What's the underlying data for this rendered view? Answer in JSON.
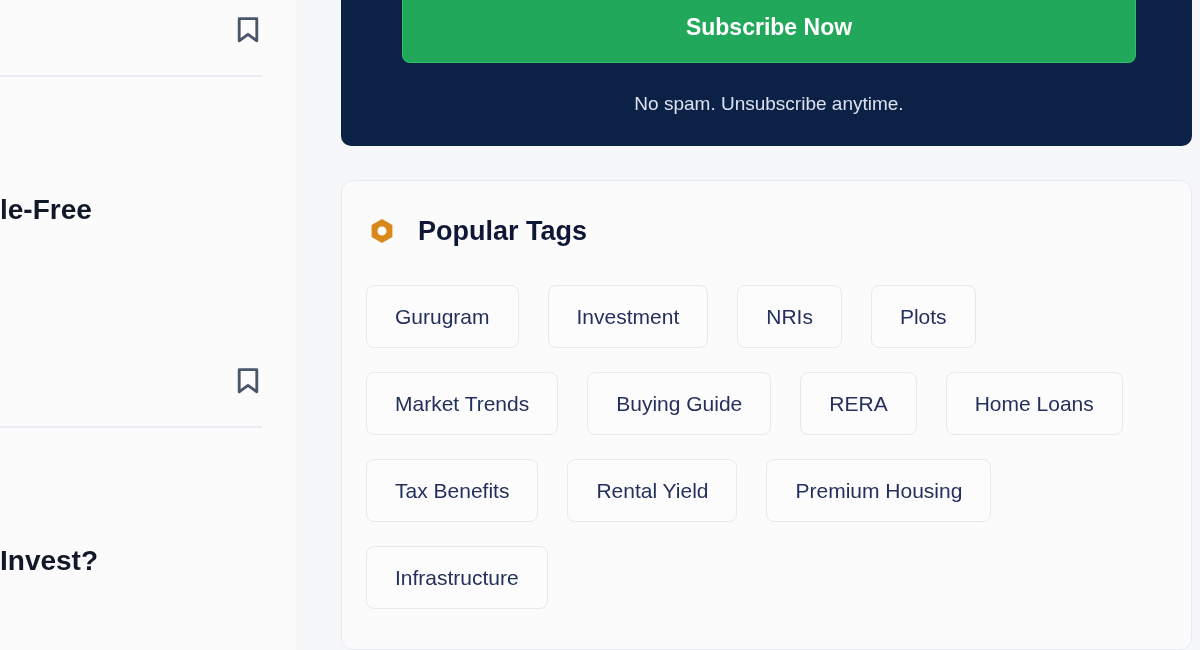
{
  "articles": [
    {
      "bookmarked": false
    },
    {
      "title": "le-Free",
      "bookmarked": false
    },
    {
      "title": "Invest?"
    }
  ],
  "newsletter": {
    "button": "Subscribe Now",
    "note": "No spam. Unsubscribe anytime."
  },
  "popular_tags": {
    "title": "Popular Tags",
    "tags": [
      "Gurugram",
      "Investment",
      "NRIs",
      "Plots",
      "Market Trends",
      "Buying Guide",
      "RERA",
      "Home Loans",
      "Tax Benefits",
      "Rental Yield",
      "Premium Housing",
      "Infrastructure"
    ]
  }
}
